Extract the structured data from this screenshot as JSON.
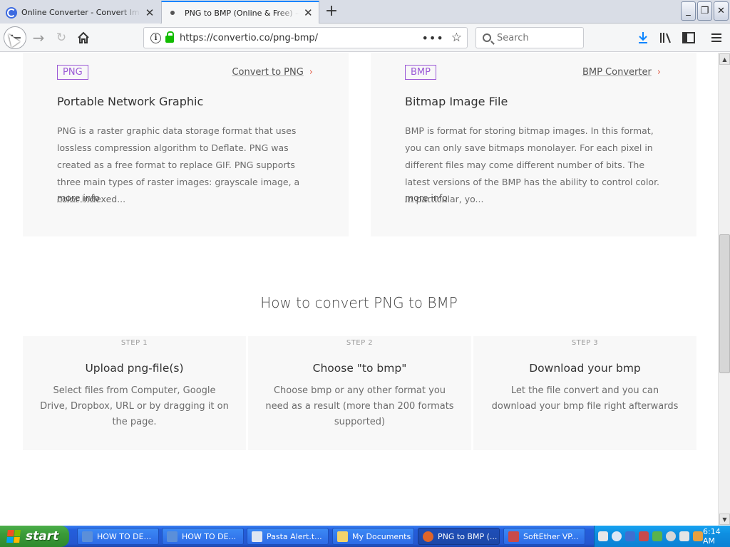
{
  "browser": {
    "tabs": [
      {
        "title": "Online Converter - Convert Image, Video, Document",
        "active": false
      },
      {
        "title": "PNG to BMP (Online & Free) — Convertio",
        "active": true
      }
    ],
    "new_tab": "+",
    "window_buttons": {
      "minimize": "_",
      "maximize": "❐",
      "close": "✕"
    },
    "url": "https://convertio.co/png-bmp/",
    "url_actions": "•••",
    "search_placeholder": "Search"
  },
  "formats": [
    {
      "tag": "PNG",
      "convert_link": "Convert to PNG",
      "title": "Portable Network Graphic",
      "description": "PNG is a raster graphic data storage format that uses lossless compression algorithm to Deflate. PNG was created as a free format to replace GIF. PNG supports three main types of raster images: grayscale image, a color indexed...",
      "more": "more info"
    },
    {
      "tag": "BMP",
      "convert_link": "BMP Converter",
      "title": "Bitmap Image File",
      "description": "BMP is format for storing bitmap images. In this format, you can only save bitmaps monolayer. For each pixel in different files may come different number of bits. The latest versions of the BMP has the ability to control color. In particular, yo...",
      "more": "more info"
    }
  ],
  "howto": {
    "title": "How to convert PNG to BMP",
    "steps": [
      {
        "label": "STEP 1",
        "title": "Upload png-file(s)",
        "text": "Select files from Computer, Google Drive, Dropbox, URL or by dragging it on the page."
      },
      {
        "label": "STEP 2",
        "title": "Choose \"to bmp\"",
        "text": "Choose bmp or any other format you need as a result (more than 200 formats supported)"
      },
      {
        "label": "STEP 3",
        "title": "Download your bmp",
        "text": "Let the file convert and you can download your bmp file right afterwards"
      }
    ]
  },
  "taskbar": {
    "start": "start",
    "items": [
      {
        "label": "HOW TO DE...",
        "icon_color": "#5b8fd9"
      },
      {
        "label": "HOW TO DE...",
        "icon_color": "#5b8fd9"
      },
      {
        "label": "Pasta Alert.t...",
        "icon_color": "#dfe6f2"
      },
      {
        "label": "My Documents",
        "icon_color": "#f3d36b"
      },
      {
        "label": "PNG to BMP (...",
        "icon_color": "#e0652a",
        "active": true
      },
      {
        "label": "SoftEther VP...",
        "icon_color": "#c84a4a"
      }
    ],
    "clock": "6:14 AM"
  },
  "colors": {
    "tag_purple": "#9b59d6",
    "chevron_red": "#e3604b",
    "focus_blue": "#0a84ff"
  }
}
